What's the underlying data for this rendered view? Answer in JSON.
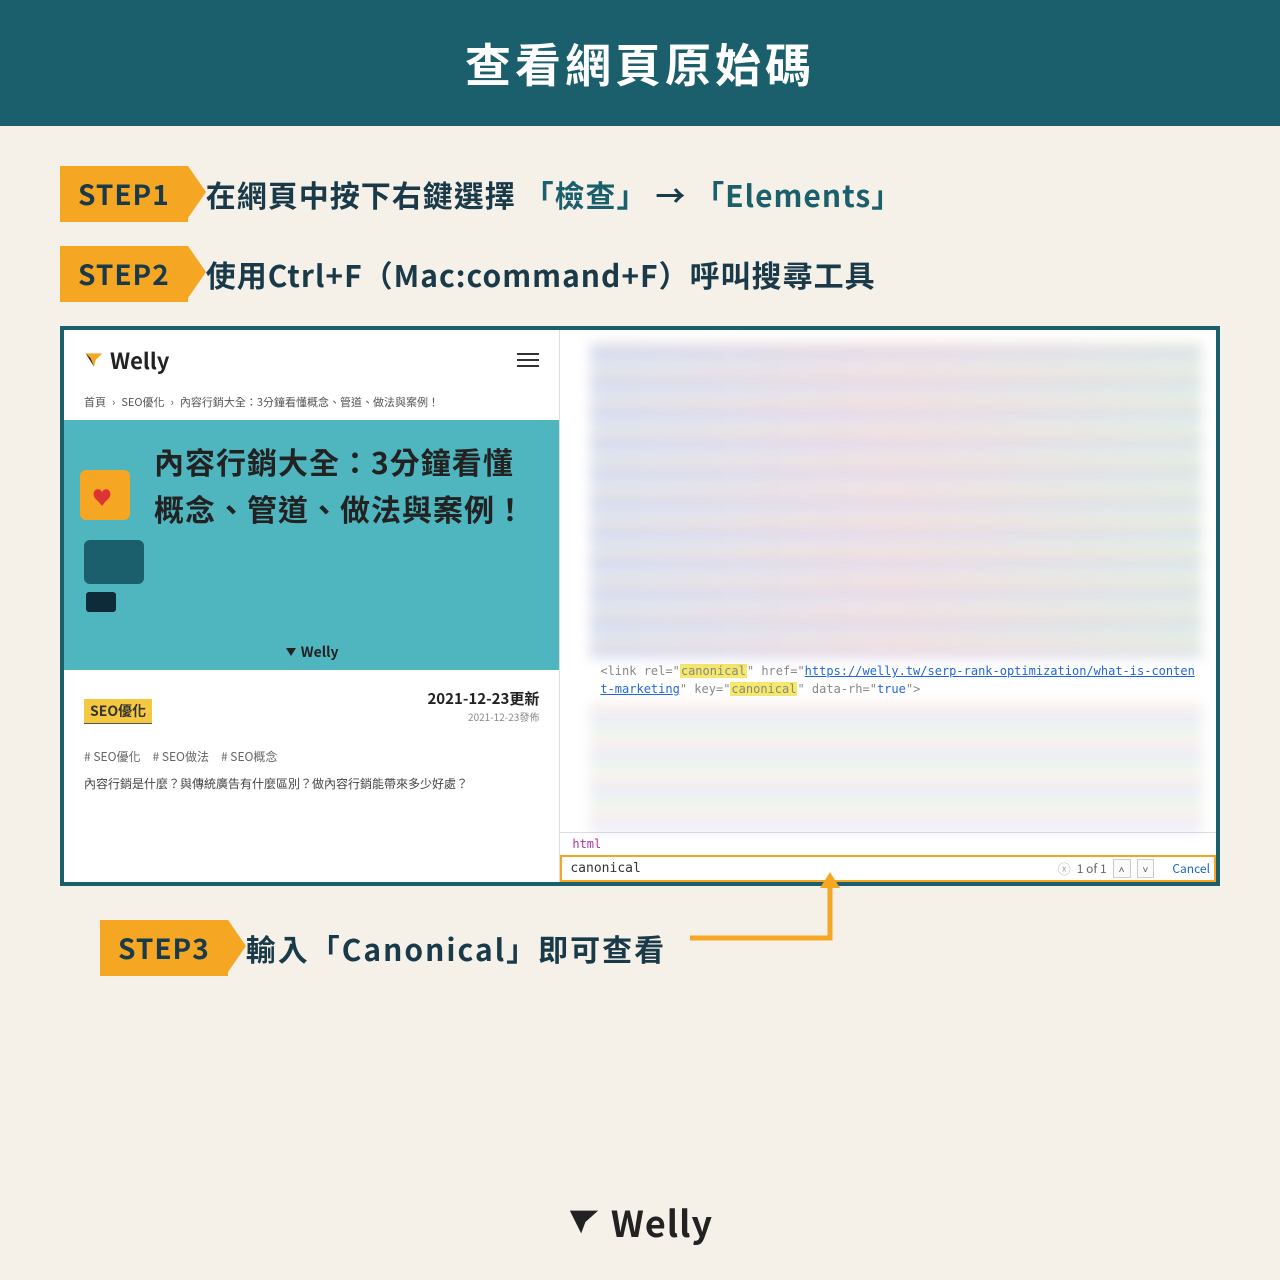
{
  "header": {
    "title": "查看網頁原始碼"
  },
  "steps": {
    "s1": {
      "tag": "STEP1",
      "prefix": "在網頁中按下右鍵選擇",
      "hl1": "「檢查」",
      "arrow": "→",
      "hl2": "「Elements」"
    },
    "s2": {
      "tag": "STEP2",
      "text": "使用Ctrl+F（Mac:command+F）呼叫搜尋工具"
    },
    "s3": {
      "tag": "STEP3",
      "text": "輸入「Canonical」即可查看"
    }
  },
  "mobile": {
    "brand": "Welly",
    "breadcrumb": [
      "首頁",
      "SEO優化",
      "內容行銷大全：3分鐘看懂概念、管道、做法與案例！"
    ],
    "heroTitle": "內容行銷大全：3分鐘看懂概念、管道、做法與案例！",
    "heroBrand": "Welly",
    "seoBadge": "SEO優化",
    "dateMain": "2021-12-23更新",
    "dateSub": "2021-12-23發佈",
    "tags": "# SEO優化　# SEO做法　# SEO概念",
    "desc": "內容行銷是什麼？與傳統廣告有什麼區別？做內容行銷能帶來多少好處？"
  },
  "devtools": {
    "codeLine": {
      "prefix": "<link rel=\"",
      "rel": "canonical",
      "mid1": "\" href=\"",
      "url": "https://welly.tw/serp-rank-optimization/what-is-content-marketing",
      "mid2": "\" key=\"",
      "key": "canonical",
      "mid3": "\" data-rh=\"",
      "rh": "true",
      "suffix": "\">"
    },
    "htmlLabel": "html",
    "search": {
      "value": "canonical",
      "count": "1 of 1",
      "cancel": "Cancel"
    }
  },
  "footer": {
    "brand": "Welly"
  }
}
